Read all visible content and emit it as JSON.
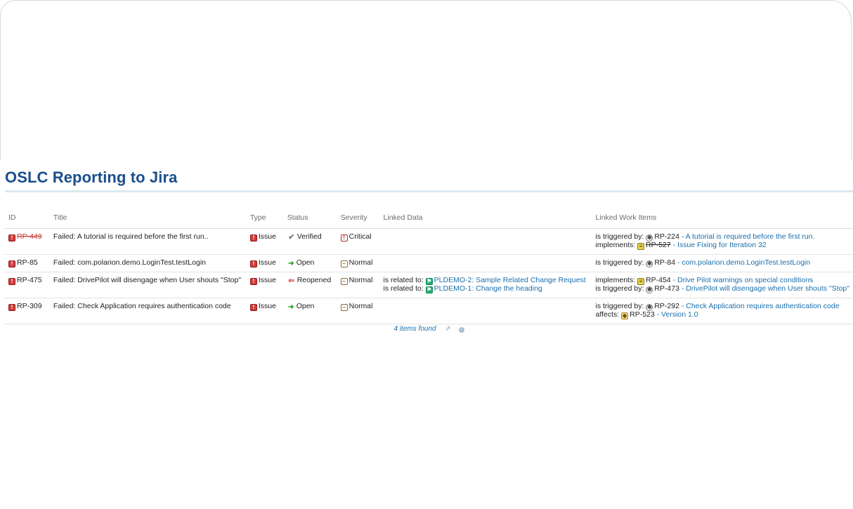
{
  "page": {
    "title": "OSLC Reporting to Jira"
  },
  "table": {
    "columns": [
      "ID",
      "Title",
      "Type",
      "Status",
      "Severity",
      "Linked Data",
      "Linked Work Items"
    ],
    "rows": [
      {
        "id": "RP-449",
        "id_struck": true,
        "title": "Failed: A tutorial  is required before the first run..",
        "type": "Issue",
        "status": "Verified",
        "severity": "Critical",
        "linked_data": [],
        "linked_work_items": [
          {
            "role": "is triggered by:",
            "icon": "test-case-icon",
            "id": "RP-224",
            "struck": false,
            "text": "- A tutorial is required before the first run."
          },
          {
            "role": "implements:",
            "icon": "requirement-icon",
            "id": "RP-527",
            "struck": true,
            "text": "- Issue Fixing for Iteration 32"
          }
        ]
      },
      {
        "id": "RP-85",
        "id_struck": false,
        "title": "Failed: com.polarion.demo.LoginTest.testLogin",
        "type": "Issue",
        "status": "Open",
        "severity": "Normal",
        "linked_data": [],
        "linked_work_items": [
          {
            "role": "is triggered by:",
            "icon": "test-case-icon",
            "id": "RP-84",
            "struck": false,
            "text": "- com.polarion.demo.LoginTest.testLogin"
          }
        ]
      },
      {
        "id": "RP-475",
        "id_struck": false,
        "title": "Failed: DrivePilot will disengage when User shouts \"Stop\"",
        "type": "Issue",
        "status": "Reopened",
        "severity": "Normal",
        "linked_data": [
          {
            "role": "is related to:",
            "icon": "change-request-icon",
            "text": "PLDEMO-2: Sample Related Change Request"
          },
          {
            "role": "is related to:",
            "icon": "change-request-icon",
            "text": "PLDEMO-1: Change the heading"
          }
        ],
        "linked_work_items": [
          {
            "role": "implements:",
            "icon": "requirement-icon",
            "id": "RP-454",
            "struck": false,
            "text": "- Drive Pilot warnings on special conditions"
          },
          {
            "role": "is triggered by:",
            "icon": "test-case-icon",
            "id": "RP-473",
            "struck": false,
            "text": "- DrivePilot will disengage when User shouts \"Stop\""
          }
        ]
      },
      {
        "id": "RP-309",
        "id_struck": false,
        "title": "Failed: Check Application requires authentication code",
        "type": "Issue",
        "status": "Open",
        "severity": "Normal",
        "linked_data": [],
        "linked_work_items": [
          {
            "role": "is triggered by:",
            "icon": "test-case-icon",
            "id": "RP-292",
            "struck": false,
            "text": "- Check Application requires authentication code"
          },
          {
            "role": "affects:",
            "icon": "version-icon",
            "id": "RP-523",
            "struck": false,
            "text": "- Version 1.0"
          }
        ]
      }
    ]
  },
  "footer": {
    "count_text": "4 items found"
  },
  "colors": {
    "title": "#1a4e8a",
    "link": "#1b6fad",
    "struck_id": "#c0392b",
    "open": "#2aa52a",
    "reopened": "#e05050"
  }
}
